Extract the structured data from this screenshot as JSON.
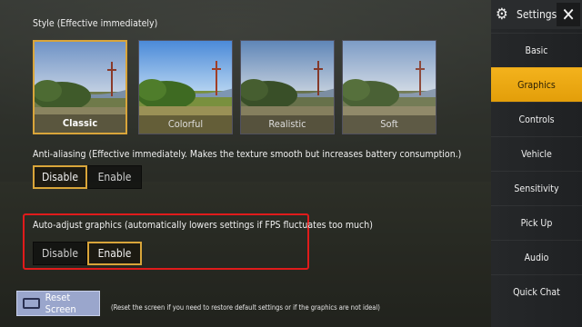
{
  "style_section": {
    "title": "Style (Effective immediately)",
    "options": [
      {
        "label": "Classic",
        "selected": true
      },
      {
        "label": "Colorful",
        "selected": false
      },
      {
        "label": "Realistic",
        "selected": false
      },
      {
        "label": "Soft",
        "selected": false
      }
    ]
  },
  "anti_aliasing": {
    "title": "Anti-aliasing (Effective immediately. Makes the texture smooth but increases battery consumption.)",
    "disable_label": "Disable",
    "enable_label": "Enable",
    "selected": "Disable"
  },
  "auto_adjust": {
    "title": "Auto-adjust graphics (automatically lowers settings if FPS fluctuates too much)",
    "disable_label": "Disable",
    "enable_label": "Enable",
    "selected": "Enable"
  },
  "reset": {
    "button_label": "Reset Screen",
    "note": "(Reset the screen if you need to restore default settings or if the graphics are not ideal)"
  },
  "sidebar": {
    "title": "Settings",
    "gear_icon": "gear-icon",
    "close_icon": "close-icon",
    "close_glyph": "✕",
    "items": [
      {
        "label": "Basic",
        "active": false
      },
      {
        "label": "Graphics",
        "active": true
      },
      {
        "label": "Controls",
        "active": false
      },
      {
        "label": "Vehicle",
        "active": false
      },
      {
        "label": "Sensitivity",
        "active": false
      },
      {
        "label": "Pick Up",
        "active": false
      },
      {
        "label": "Audio",
        "active": false
      },
      {
        "label": "Quick Chat",
        "active": false
      }
    ]
  },
  "colors": {
    "accent": "#e9a50f",
    "selection_border": "#d9a53a",
    "highlight_red": "#e01b1b"
  }
}
